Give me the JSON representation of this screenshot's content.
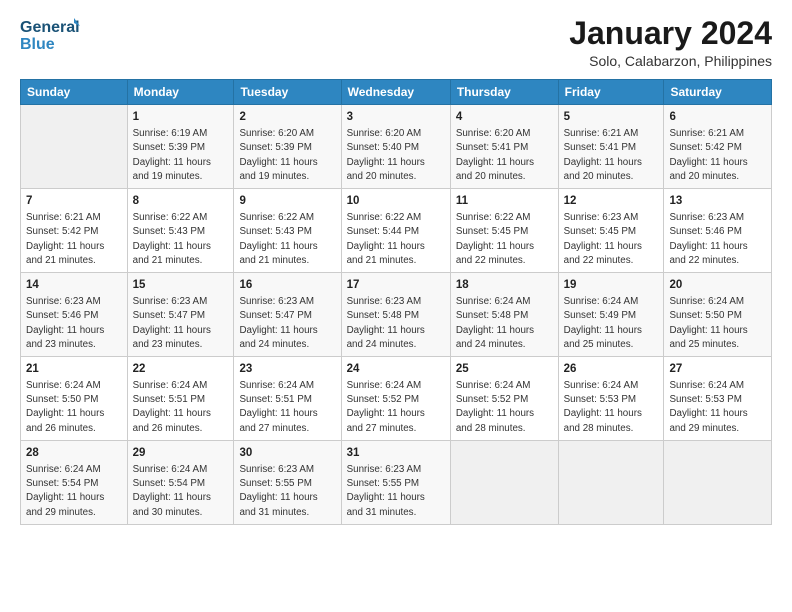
{
  "header": {
    "logo_line1": "General",
    "logo_line2": "Blue",
    "month_title": "January 2024",
    "subtitle": "Solo, Calabarzon, Philippines"
  },
  "days_of_week": [
    "Sunday",
    "Monday",
    "Tuesday",
    "Wednesday",
    "Thursday",
    "Friday",
    "Saturday"
  ],
  "weeks": [
    [
      {
        "day": "",
        "info": ""
      },
      {
        "day": "1",
        "info": "Sunrise: 6:19 AM\nSunset: 5:39 PM\nDaylight: 11 hours\nand 19 minutes."
      },
      {
        "day": "2",
        "info": "Sunrise: 6:20 AM\nSunset: 5:39 PM\nDaylight: 11 hours\nand 19 minutes."
      },
      {
        "day": "3",
        "info": "Sunrise: 6:20 AM\nSunset: 5:40 PM\nDaylight: 11 hours\nand 20 minutes."
      },
      {
        "day": "4",
        "info": "Sunrise: 6:20 AM\nSunset: 5:41 PM\nDaylight: 11 hours\nand 20 minutes."
      },
      {
        "day": "5",
        "info": "Sunrise: 6:21 AM\nSunset: 5:41 PM\nDaylight: 11 hours\nand 20 minutes."
      },
      {
        "day": "6",
        "info": "Sunrise: 6:21 AM\nSunset: 5:42 PM\nDaylight: 11 hours\nand 20 minutes."
      }
    ],
    [
      {
        "day": "7",
        "info": "Sunrise: 6:21 AM\nSunset: 5:42 PM\nDaylight: 11 hours\nand 21 minutes."
      },
      {
        "day": "8",
        "info": "Sunrise: 6:22 AM\nSunset: 5:43 PM\nDaylight: 11 hours\nand 21 minutes."
      },
      {
        "day": "9",
        "info": "Sunrise: 6:22 AM\nSunset: 5:43 PM\nDaylight: 11 hours\nand 21 minutes."
      },
      {
        "day": "10",
        "info": "Sunrise: 6:22 AM\nSunset: 5:44 PM\nDaylight: 11 hours\nand 21 minutes."
      },
      {
        "day": "11",
        "info": "Sunrise: 6:22 AM\nSunset: 5:45 PM\nDaylight: 11 hours\nand 22 minutes."
      },
      {
        "day": "12",
        "info": "Sunrise: 6:23 AM\nSunset: 5:45 PM\nDaylight: 11 hours\nand 22 minutes."
      },
      {
        "day": "13",
        "info": "Sunrise: 6:23 AM\nSunset: 5:46 PM\nDaylight: 11 hours\nand 22 minutes."
      }
    ],
    [
      {
        "day": "14",
        "info": "Sunrise: 6:23 AM\nSunset: 5:46 PM\nDaylight: 11 hours\nand 23 minutes."
      },
      {
        "day": "15",
        "info": "Sunrise: 6:23 AM\nSunset: 5:47 PM\nDaylight: 11 hours\nand 23 minutes."
      },
      {
        "day": "16",
        "info": "Sunrise: 6:23 AM\nSunset: 5:47 PM\nDaylight: 11 hours\nand 24 minutes."
      },
      {
        "day": "17",
        "info": "Sunrise: 6:23 AM\nSunset: 5:48 PM\nDaylight: 11 hours\nand 24 minutes."
      },
      {
        "day": "18",
        "info": "Sunrise: 6:24 AM\nSunset: 5:48 PM\nDaylight: 11 hours\nand 24 minutes."
      },
      {
        "day": "19",
        "info": "Sunrise: 6:24 AM\nSunset: 5:49 PM\nDaylight: 11 hours\nand 25 minutes."
      },
      {
        "day": "20",
        "info": "Sunrise: 6:24 AM\nSunset: 5:50 PM\nDaylight: 11 hours\nand 25 minutes."
      }
    ],
    [
      {
        "day": "21",
        "info": "Sunrise: 6:24 AM\nSunset: 5:50 PM\nDaylight: 11 hours\nand 26 minutes."
      },
      {
        "day": "22",
        "info": "Sunrise: 6:24 AM\nSunset: 5:51 PM\nDaylight: 11 hours\nand 26 minutes."
      },
      {
        "day": "23",
        "info": "Sunrise: 6:24 AM\nSunset: 5:51 PM\nDaylight: 11 hours\nand 27 minutes."
      },
      {
        "day": "24",
        "info": "Sunrise: 6:24 AM\nSunset: 5:52 PM\nDaylight: 11 hours\nand 27 minutes."
      },
      {
        "day": "25",
        "info": "Sunrise: 6:24 AM\nSunset: 5:52 PM\nDaylight: 11 hours\nand 28 minutes."
      },
      {
        "day": "26",
        "info": "Sunrise: 6:24 AM\nSunset: 5:53 PM\nDaylight: 11 hours\nand 28 minutes."
      },
      {
        "day": "27",
        "info": "Sunrise: 6:24 AM\nSunset: 5:53 PM\nDaylight: 11 hours\nand 29 minutes."
      }
    ],
    [
      {
        "day": "28",
        "info": "Sunrise: 6:24 AM\nSunset: 5:54 PM\nDaylight: 11 hours\nand 29 minutes."
      },
      {
        "day": "29",
        "info": "Sunrise: 6:24 AM\nSunset: 5:54 PM\nDaylight: 11 hours\nand 30 minutes."
      },
      {
        "day": "30",
        "info": "Sunrise: 6:23 AM\nSunset: 5:55 PM\nDaylight: 11 hours\nand 31 minutes."
      },
      {
        "day": "31",
        "info": "Sunrise: 6:23 AM\nSunset: 5:55 PM\nDaylight: 11 hours\nand 31 minutes."
      },
      {
        "day": "",
        "info": ""
      },
      {
        "day": "",
        "info": ""
      },
      {
        "day": "",
        "info": ""
      }
    ]
  ]
}
